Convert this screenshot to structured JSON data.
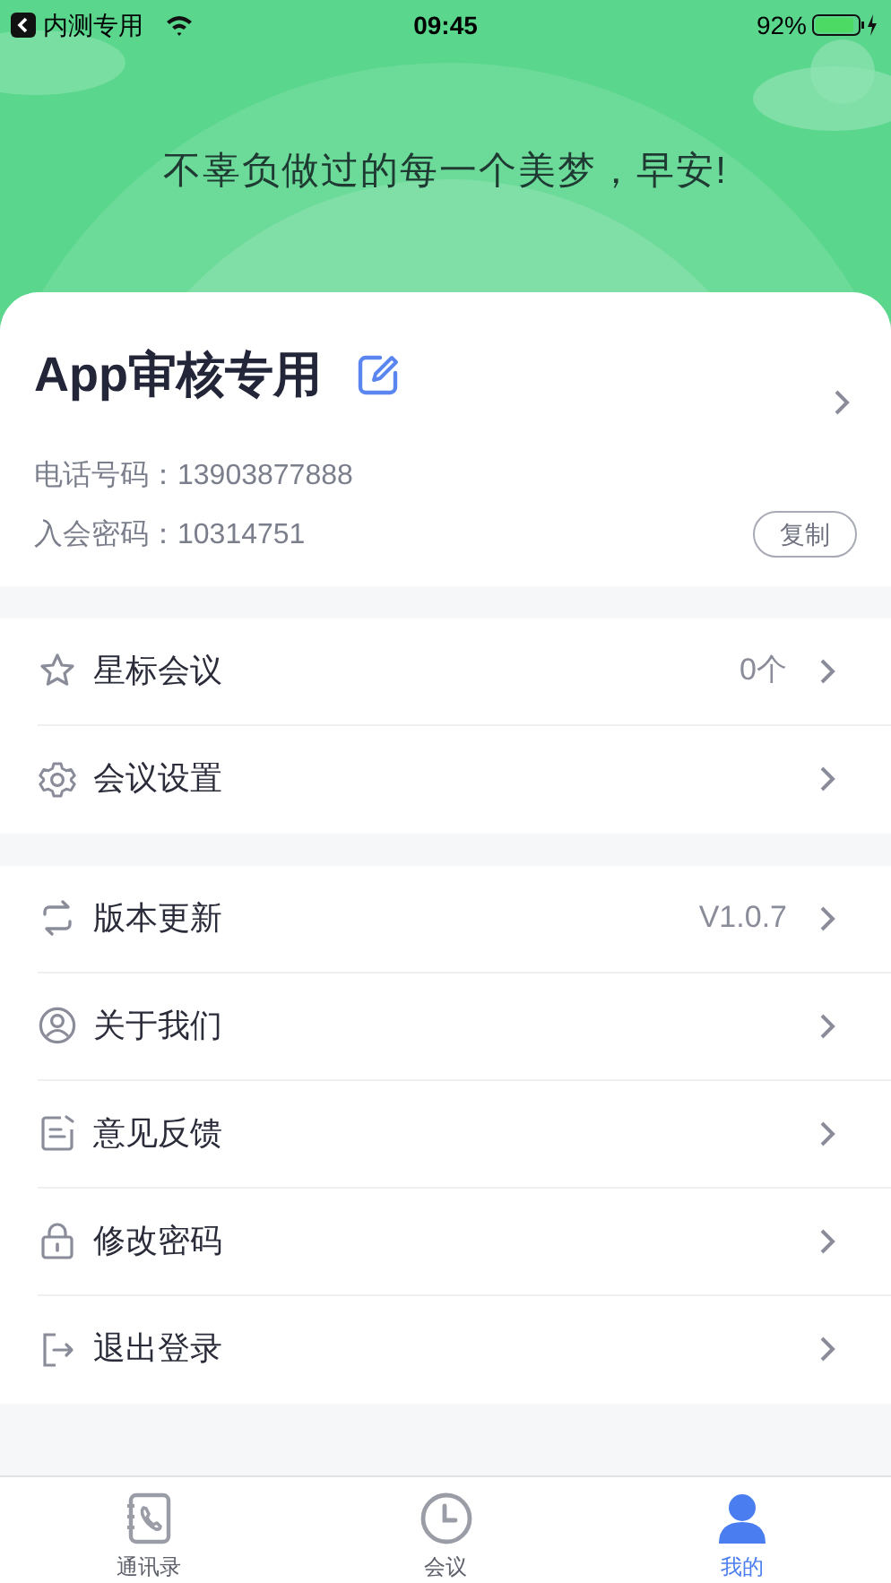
{
  "status_bar": {
    "carrier": "内测专用",
    "time": "09:45",
    "battery": "92%"
  },
  "header": {
    "greeting": "不辜负做过的每一个美梦，早安!"
  },
  "profile": {
    "name": "App审核专用",
    "phone_label": "电话号码：",
    "phone": "13903877888",
    "password_label": "入会密码：",
    "password": "10314751",
    "copy_button": "复制"
  },
  "menu_groups": [
    {
      "items": [
        {
          "label": "星标会议",
          "value": "0个"
        },
        {
          "label": "会议设置"
        }
      ]
    },
    {
      "items": [
        {
          "label": "版本更新",
          "value": "V1.0.7"
        },
        {
          "label": "关于我们"
        },
        {
          "label": "意见反馈"
        },
        {
          "label": "修改密码"
        },
        {
          "label": "退出登录"
        }
      ]
    }
  ],
  "tabs": [
    {
      "label": "通讯录",
      "selected": false
    },
    {
      "label": "会议",
      "selected": false
    },
    {
      "label": "我的",
      "selected": true
    }
  ]
}
